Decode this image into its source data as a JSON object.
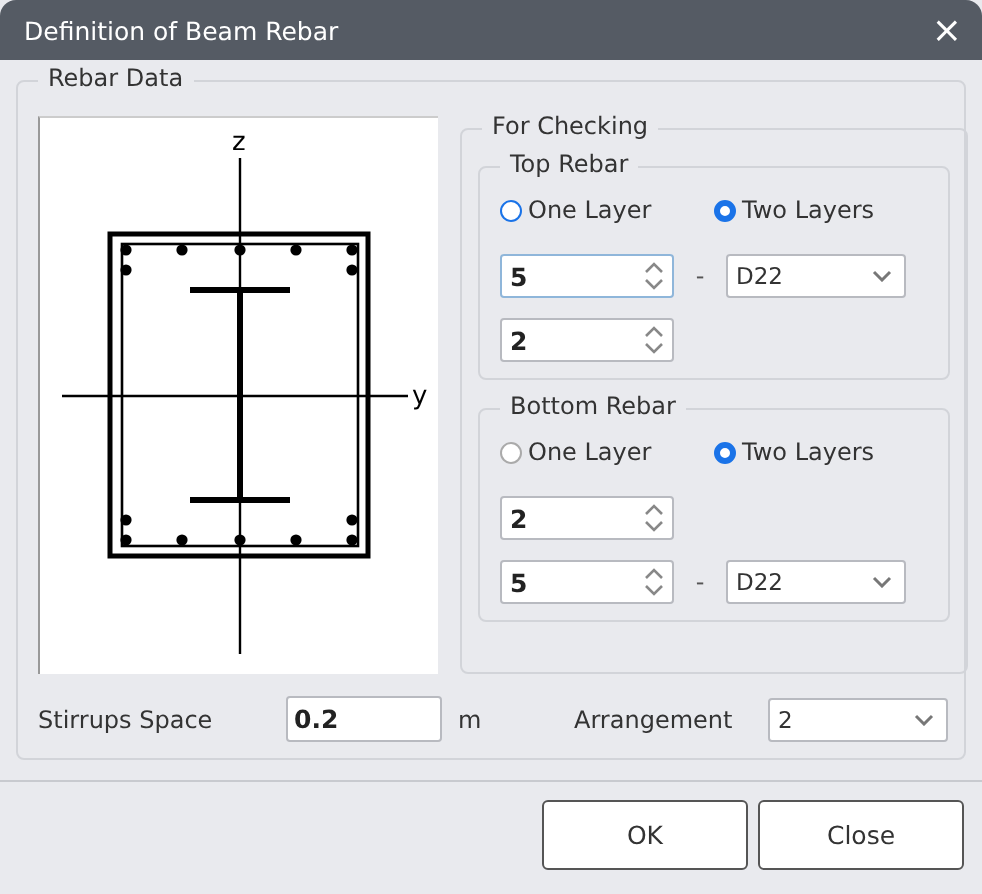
{
  "window": {
    "title": "Definition of Beam Rebar",
    "close": "×"
  },
  "rebar_data": {
    "title": "Rebar Data",
    "section": {
      "axis_z": "z",
      "axis_y": "y"
    },
    "for_checking": {
      "title": "For Checking",
      "groups": [
        {
          "title": "Top Rebar",
          "options": [
            {
              "label": "One Layer",
              "selected": false
            },
            {
              "label": "Two Layers",
              "selected": true
            }
          ],
          "rows": [
            {
              "value": "5",
              "dash": "-",
              "size": "D22",
              "focused": true
            },
            {
              "value": "2",
              "focused": false
            }
          ]
        },
        {
          "title": "Bottom Rebar",
          "options": [
            {
              "label": "One Layer",
              "selected": false
            },
            {
              "label": "Two Layers",
              "selected": true
            }
          ],
          "rows": [
            {
              "value": "2",
              "focused": false
            },
            {
              "value": "5",
              "dash": "-",
              "size": "D22",
              "focused": false
            }
          ]
        }
      ]
    },
    "stirrups": {
      "label": "Stirrups Space",
      "value": "0.2",
      "unit": "m"
    },
    "arrangement": {
      "label": "Arrangement",
      "value": "2"
    }
  },
  "buttons": [
    "OK",
    "Close"
  ]
}
